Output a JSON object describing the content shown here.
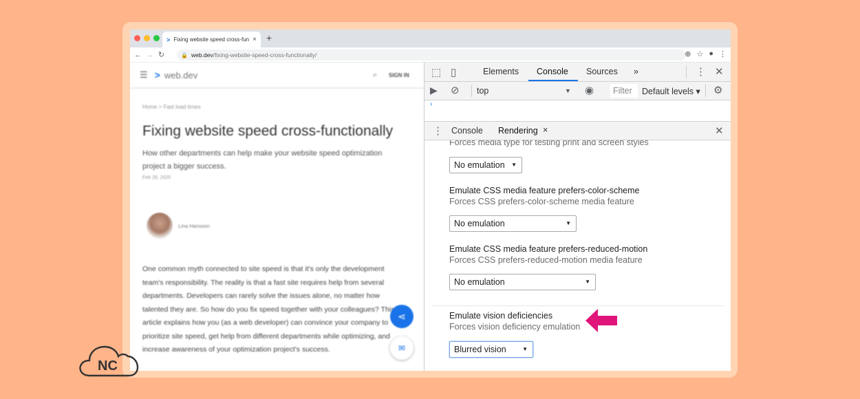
{
  "browser": {
    "tab_title": "Fixing website speed cross-func",
    "tab_close": "×",
    "new_tab": "+",
    "url_host": "web.dev",
    "url_path": "/fixing-website-speed-cross-functionally/"
  },
  "page": {
    "brand": "web.dev",
    "sign_in": "SIGN IN",
    "breadcrumb": "Home  >  Fast load times",
    "title": "Fixing website speed cross-functionally",
    "subtitle": "How other departments can help make your website speed optimization project a bigger success.",
    "date": "Feb 28, 2020",
    "author": "Lina Hansson",
    "body": "One common myth connected to site speed is that it's only the development team's responsibility. The reality is that a fast site requires help from several departments. Developers can rarely solve the issues alone, no matter how talented they are. So how do you fix speed together with your colleagues? This article explains how you (as a web developer) can convince your company to prioritize site speed, get help from different departments while optimizing, and increase awareness of your optimization project's success."
  },
  "devtools": {
    "tabs": [
      "Elements",
      "Console",
      "Sources",
      "»"
    ],
    "active_tab": "Console",
    "context": "top",
    "filter_placeholder": "Filter",
    "levels": "Default levels ▾",
    "drawer_tabs": [
      "Console",
      "Rendering"
    ],
    "drawer_close_tab": "×",
    "rendering": {
      "media_desc": "Forces media type for testing print and screen styles",
      "media_value": "No emulation",
      "color_scheme_title": "Emulate CSS media feature prefers-color-scheme",
      "color_scheme_desc": "Forces CSS prefers-color-scheme media feature",
      "color_scheme_value": "No emulation",
      "reduced_motion_title": "Emulate CSS media feature prefers-reduced-motion",
      "reduced_motion_desc": "Forces CSS prefers-reduced-motion media feature",
      "reduced_motion_value": "No emulation",
      "vision_title": "Emulate vision deficiencies",
      "vision_desc": "Forces vision deficiency emulation",
      "vision_value": "Blurred vision"
    }
  },
  "watermark": {
    "text": "NC"
  },
  "colors": {
    "background": "#ffb489",
    "accent": "#1a73e8",
    "arrow": "#e0157a"
  }
}
